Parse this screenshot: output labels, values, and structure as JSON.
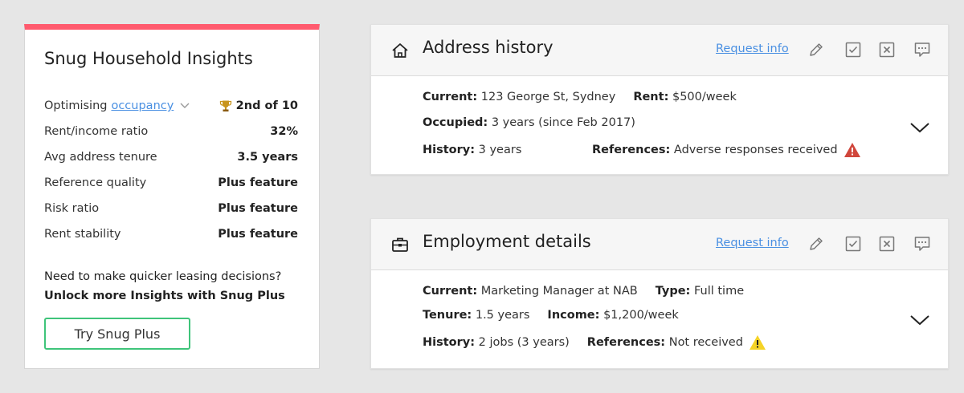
{
  "insights": {
    "title": "Snug Household Insights",
    "optimising_label": "Optimising",
    "optimising_link": "occupancy",
    "rank": "2nd of 10",
    "metrics": [
      {
        "label": "Rent/income ratio",
        "value": "32%"
      },
      {
        "label": "Avg address tenure",
        "value": "3.5 years"
      },
      {
        "label": "Reference quality",
        "value": "Plus feature"
      },
      {
        "label": "Risk ratio",
        "value": "Plus feature"
      },
      {
        "label": "Rent stability",
        "value": "Plus feature"
      }
    ],
    "promo_text": "Need to make quicker leasing decisions?",
    "promo_strong": "Unlock more Insights with Snug Plus",
    "cta": "Try Snug Plus",
    "accent_color": "#ff5a6e",
    "cta_border_color": "#3fc47a"
  },
  "address": {
    "title": "Address history",
    "request_info": "Request info",
    "current_label": "Current:",
    "current_value": "123 George St, Sydney",
    "rent_label": "Rent:",
    "rent_value": "$500/week",
    "occupied_label": "Occupied:",
    "occupied_value": "3 years (since Feb 2017)",
    "history_label": "History:",
    "history_value": "3 years",
    "references_label": "References:",
    "references_value": "Adverse responses received",
    "warning_color": "#d0463b",
    "icons": [
      "home-icon",
      "edit-icon",
      "check-icon",
      "close-icon",
      "comment-icon",
      "chevron-down-icon"
    ]
  },
  "employment": {
    "title": "Employment details",
    "request_info": "Request info",
    "current_label": "Current:",
    "current_value": "Marketing Manager at NAB",
    "type_label": "Type:",
    "type_value": "Full time",
    "tenure_label": "Tenure:",
    "tenure_value": "1.5 years",
    "income_label": "Income:",
    "income_value": "$1,200/week",
    "history_label": "History:",
    "history_value": "2 jobs (3 years)",
    "references_label": "References:",
    "references_value": "Not received",
    "warning_color": "#f5d327",
    "icons": [
      "briefcase-icon",
      "edit-icon",
      "check-icon",
      "close-icon",
      "comment-icon",
      "chevron-down-icon"
    ]
  },
  "colors": {
    "link": "#4a90e2",
    "page_background": "#e6e6e6"
  }
}
